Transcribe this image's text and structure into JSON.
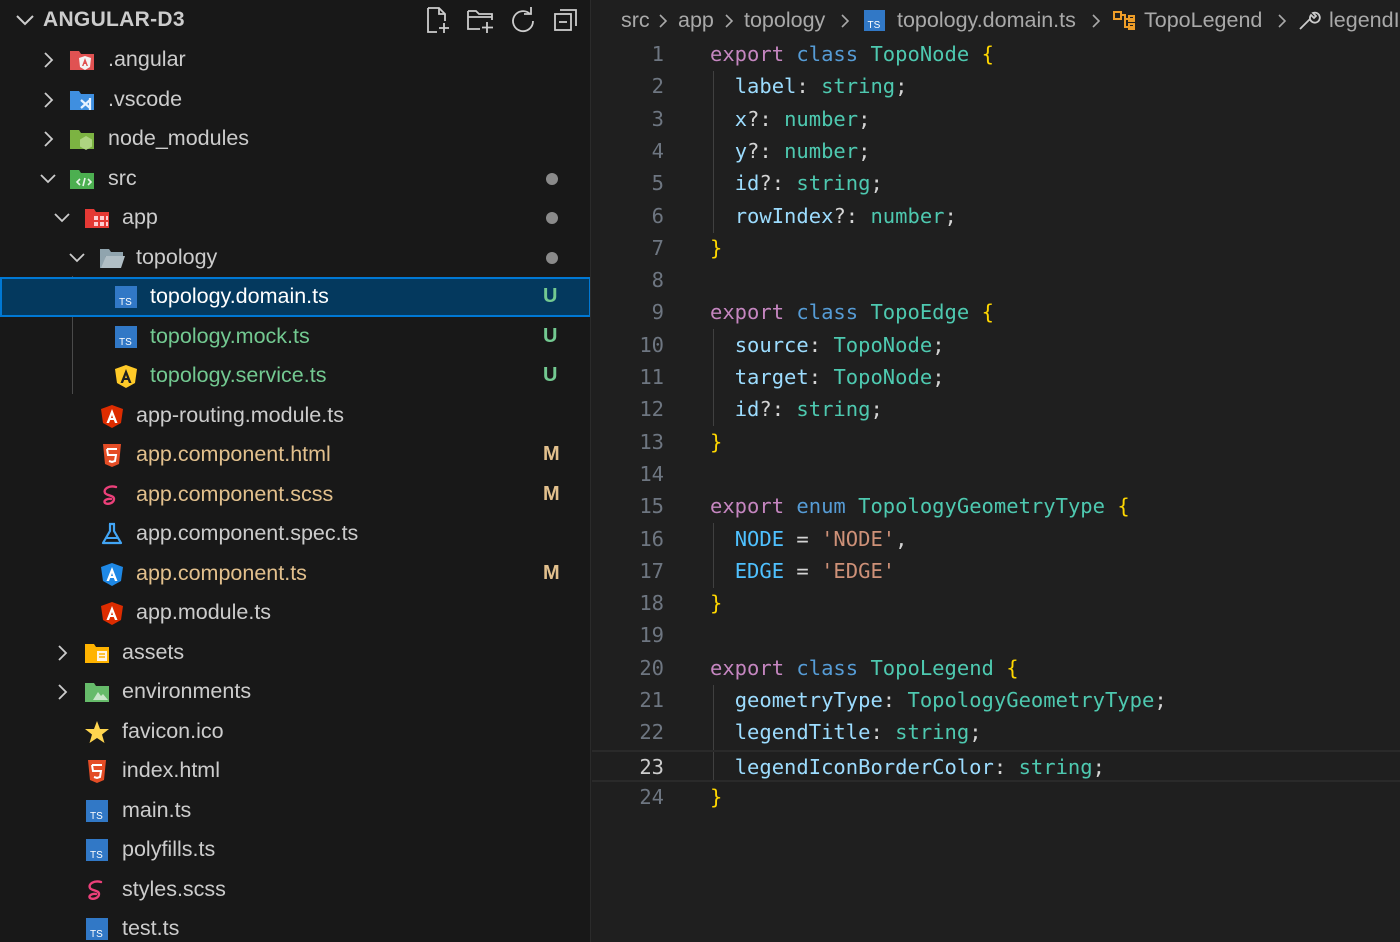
{
  "explorer": {
    "title": "ANGULAR-D3",
    "actions": [
      "new-file-icon",
      "new-folder-icon",
      "refresh-icon",
      "collapse-all-icon"
    ],
    "items": [
      {
        "label": ".angular",
        "type": "folder",
        "expanded": false,
        "icon": "angular-folder-icon",
        "status": ""
      },
      {
        "label": ".vscode",
        "type": "folder",
        "expanded": false,
        "icon": "vscode-folder-icon",
        "status": ""
      },
      {
        "label": "node_modules",
        "type": "folder",
        "expanded": false,
        "icon": "node-folder-icon",
        "status": ""
      },
      {
        "label": "src",
        "type": "folder",
        "expanded": true,
        "icon": "src-folder-icon",
        "status": "dot"
      },
      {
        "label": "app",
        "type": "folder",
        "expanded": true,
        "icon": "app-folder-icon",
        "status": "dot"
      },
      {
        "label": "topology",
        "type": "folder",
        "expanded": true,
        "icon": "folder-open-icon",
        "status": "dot"
      },
      {
        "label": "topology.domain.ts",
        "type": "file",
        "icon": "typescript-icon",
        "status": "U",
        "selected": true
      },
      {
        "label": "topology.mock.ts",
        "type": "file",
        "icon": "typescript-icon",
        "status": "U"
      },
      {
        "label": "topology.service.ts",
        "type": "file",
        "icon": "angular-service-icon",
        "status": "U"
      },
      {
        "label": "app-routing.module.ts",
        "type": "file",
        "icon": "angular-icon",
        "status": ""
      },
      {
        "label": "app.component.html",
        "type": "file",
        "icon": "html-icon",
        "status": "M"
      },
      {
        "label": "app.component.scss",
        "type": "file",
        "icon": "sass-icon",
        "status": "M"
      },
      {
        "label": "app.component.spec.ts",
        "type": "file",
        "icon": "test-flask-icon",
        "status": ""
      },
      {
        "label": "app.component.ts",
        "type": "file",
        "icon": "angular-component-icon",
        "status": "M"
      },
      {
        "label": "app.module.ts",
        "type": "file",
        "icon": "angular-icon",
        "status": ""
      },
      {
        "label": "assets",
        "type": "folder",
        "expanded": false,
        "icon": "assets-folder-icon",
        "status": ""
      },
      {
        "label": "environments",
        "type": "folder",
        "expanded": false,
        "icon": "environments-folder-icon",
        "status": ""
      },
      {
        "label": "favicon.ico",
        "type": "file",
        "icon": "star-icon",
        "status": ""
      },
      {
        "label": "index.html",
        "type": "file",
        "icon": "html-icon",
        "status": ""
      },
      {
        "label": "main.ts",
        "type": "file",
        "icon": "typescript-icon",
        "status": ""
      },
      {
        "label": "polyfills.ts",
        "type": "file",
        "icon": "typescript-icon",
        "status": ""
      },
      {
        "label": "styles.scss",
        "type": "file",
        "icon": "sass-icon",
        "status": ""
      },
      {
        "label": "test.ts",
        "type": "file",
        "icon": "typescript-icon",
        "status": ""
      }
    ]
  },
  "breadcrumb": {
    "items": [
      "src",
      "app",
      "topology",
      "topology.domain.ts",
      "TopoLegend",
      "legendIconBorderColor"
    ],
    "icons": [
      "typescript-icon",
      "class-symbol-icon",
      "property-wrench-icon"
    ]
  },
  "editor": {
    "current_line": 23,
    "lines": [
      {
        "n": "1",
        "text": "export class TopoNode {"
      },
      {
        "n": "2",
        "text": "  label: string;"
      },
      {
        "n": "3",
        "text": "  x?: number;"
      },
      {
        "n": "4",
        "text": "  y?: number;"
      },
      {
        "n": "5",
        "text": "  id?: string;"
      },
      {
        "n": "6",
        "text": "  rowIndex?: number;"
      },
      {
        "n": "7",
        "text": "}"
      },
      {
        "n": "8",
        "text": ""
      },
      {
        "n": "9",
        "text": "export class TopoEdge {"
      },
      {
        "n": "10",
        "text": "  source: TopoNode;"
      },
      {
        "n": "11",
        "text": "  target: TopoNode;"
      },
      {
        "n": "12",
        "text": "  id?: string;"
      },
      {
        "n": "13",
        "text": "}"
      },
      {
        "n": "14",
        "text": ""
      },
      {
        "n": "15",
        "text": "export enum TopologyGeometryType {"
      },
      {
        "n": "16",
        "text": "  NODE = 'NODE',"
      },
      {
        "n": "17",
        "text": "  EDGE = 'EDGE'"
      },
      {
        "n": "18",
        "text": "}"
      },
      {
        "n": "19",
        "text": ""
      },
      {
        "n": "20",
        "text": "export class TopoLegend {"
      },
      {
        "n": "21",
        "text": "  geometryType: TopologyGeometryType;"
      },
      {
        "n": "22",
        "text": "  legendTitle: string;"
      },
      {
        "n": "23",
        "text": "  legendIconBorderColor: string;"
      },
      {
        "n": "24",
        "text": "}"
      }
    ]
  },
  "colors": {
    "status_untracked": "#73c991",
    "status_modified": "#e2c08d",
    "status_dot": "#8a8a8a",
    "selection_bg": "#04395e",
    "focus_border": "#0078d4",
    "keyword": "#c586c0",
    "storage": "#569cd6",
    "type": "#4ec9b0",
    "property": "#9cdcfe",
    "enum_member": "#4fc1ff",
    "string": "#ce9178",
    "bracket": "#ffd700"
  }
}
